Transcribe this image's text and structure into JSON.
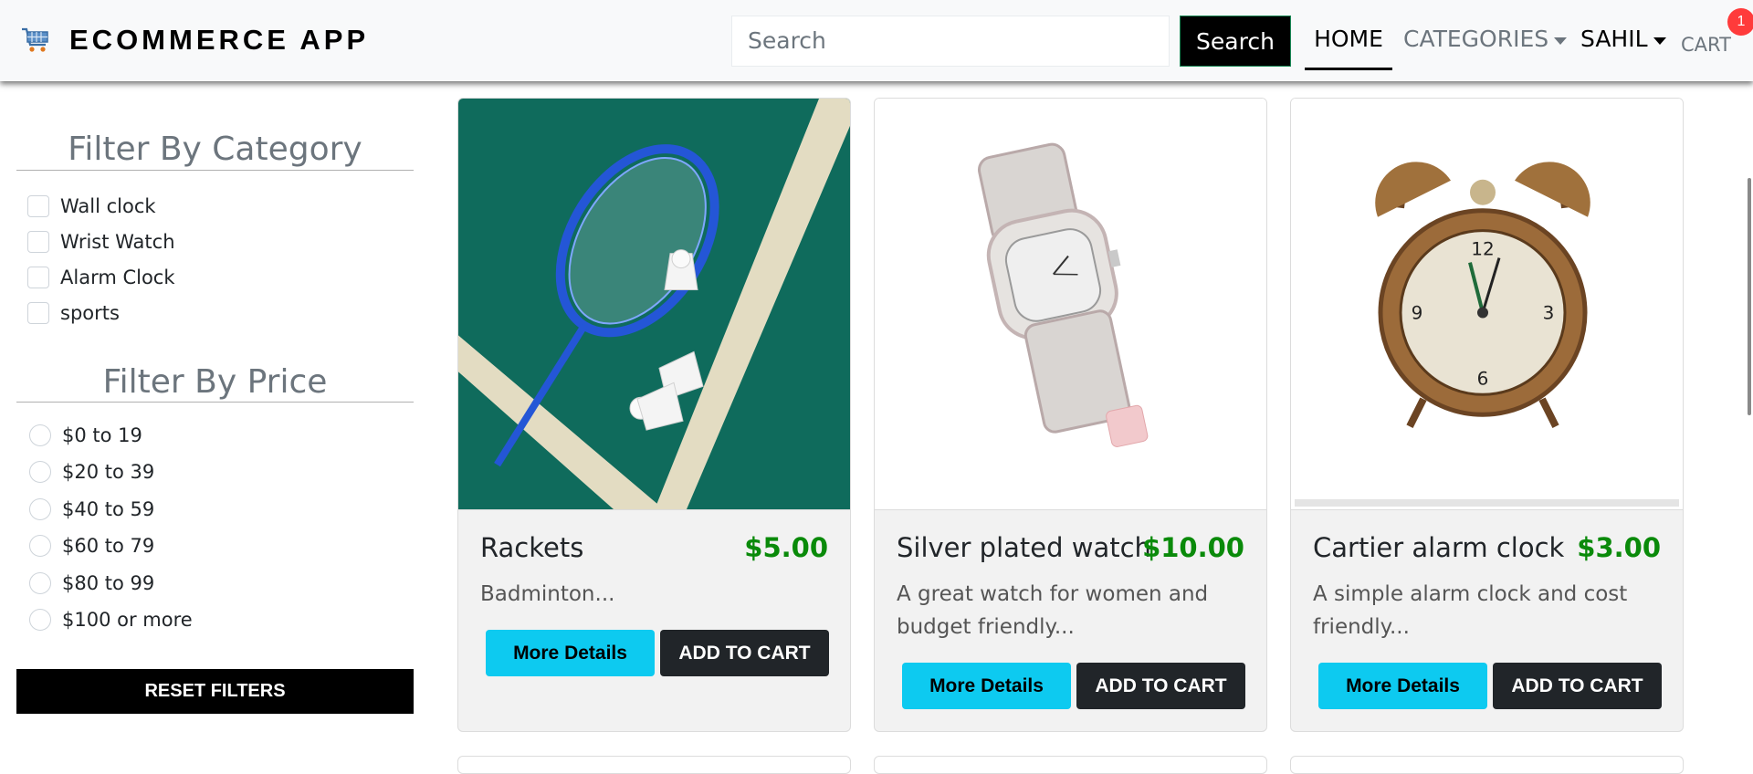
{
  "navbar": {
    "brand": "ECOMMERCE APP",
    "brand_icon": "shopping-cart-icon",
    "search_placeholder": "Search",
    "search_button": "Search",
    "home": "HOME",
    "categories": "CATEGORIES",
    "user": "SAHIL",
    "cart": "CART",
    "cart_count": "1"
  },
  "sidebar": {
    "category_title": "Filter By Category",
    "categories": [
      "Wall clock",
      "Wrist Watch",
      "Alarm Clock",
      "sports"
    ],
    "price_title": "Filter By Price",
    "prices": [
      "$0 to 19",
      "$20 to 39",
      "$40 to 59",
      "$60 to 79",
      "$80 to 99",
      "$100 or more"
    ],
    "reset_button": "RESET FILTERS"
  },
  "products": [
    {
      "name": "Rackets",
      "price": "$5.00",
      "description": "Badminton...",
      "details_button": "More Details",
      "cart_button": "ADD TO CART"
    },
    {
      "name": "Silver plated watch",
      "price": "$10.00",
      "description": "A great watch for women and budget friendly...",
      "details_button": "More Details",
      "cart_button": "ADD TO CART"
    },
    {
      "name": "Cartier alarm clock",
      "price": "$3.00",
      "description": "A simple alarm clock and cost friendly...",
      "details_button": "More Details",
      "cart_button": "ADD TO CART"
    }
  ],
  "colors": {
    "price_green": "#0a8a0a",
    "details_cyan": "#0dcaf0",
    "cart_dark": "#212529",
    "badge_red": "#ff3b3b"
  }
}
